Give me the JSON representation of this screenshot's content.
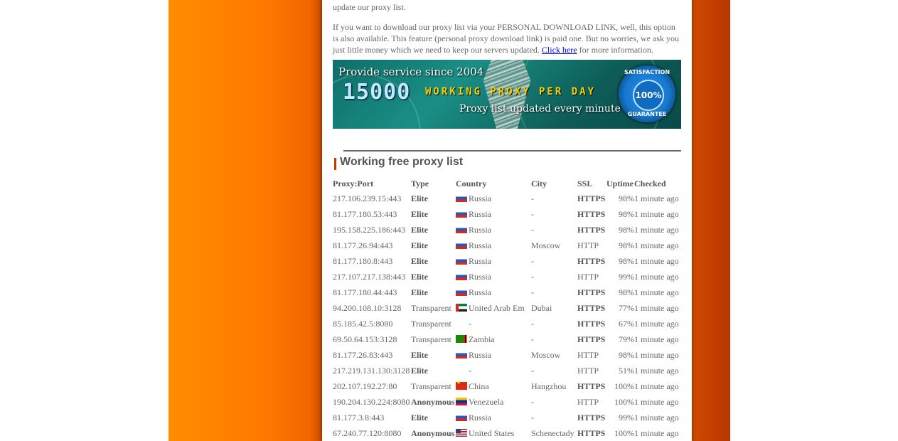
{
  "intro": {
    "para1_text": "update our proxy list.",
    "para2_text": "If you want to download our proxy list via your PERSONAL DOWNLOAD LINK, well, this option is also available. This feature (personal proxy download link) is paid one. But no worries, we ask you just little money which we need to keep our servers updated.",
    "link_label": "Click here",
    "para2_suffix": " for more information."
  },
  "banner": {
    "since": "Provide service since 2004",
    "count": "15000",
    "working": "WORKING PROXY PER DAY",
    "updated": "Proxy list updated every minute",
    "seal_top": "SATISFACTION",
    "seal_center": "100%",
    "seal_bottom": "GUARANTEE"
  },
  "section": {
    "title": "Working free proxy list"
  },
  "table": {
    "headers": [
      "Proxy:Port",
      "Type",
      "Country",
      "City",
      "SSL",
      "Uptime",
      "Checked"
    ],
    "rows": [
      {
        "proxy": "217.106.239.15:443",
        "type": "Elite",
        "flag": "ru",
        "country": "Russia",
        "city": "-",
        "ssl": "HTTPS",
        "uptime": "98%",
        "checked": "1 minute ago"
      },
      {
        "proxy": "81.177.180.53:443",
        "type": "Elite",
        "flag": "ru",
        "country": "Russia",
        "city": "-",
        "ssl": "HTTPS",
        "uptime": "98%",
        "checked": "1 minute ago"
      },
      {
        "proxy": "195.158.225.186:443",
        "type": "Elite",
        "flag": "ru",
        "country": "Russia",
        "city": "-",
        "ssl": "HTTPS",
        "uptime": "98%",
        "checked": "1 minute ago"
      },
      {
        "proxy": "81.177.26.94:443",
        "type": "Elite",
        "flag": "ru",
        "country": "Russia",
        "city": "Moscow",
        "ssl": "HTTP",
        "uptime": "98%",
        "checked": "1 minute ago"
      },
      {
        "proxy": "81.177.180.8:443",
        "type": "Elite",
        "flag": "ru",
        "country": "Russia",
        "city": "-",
        "ssl": "HTTPS",
        "uptime": "98%",
        "checked": "1 minute ago"
      },
      {
        "proxy": "217.107.217.138:443",
        "type": "Elite",
        "flag": "ru",
        "country": "Russia",
        "city": "-",
        "ssl": "HTTP",
        "uptime": "99%",
        "checked": "1 minute ago"
      },
      {
        "proxy": "81.177.180.44:443",
        "type": "Elite",
        "flag": "ru",
        "country": "Russia",
        "city": "-",
        "ssl": "HTTPS",
        "uptime": "98%",
        "checked": "1 minute ago"
      },
      {
        "proxy": "94.200.108.10:3128",
        "type": "Transparent",
        "flag": "ae",
        "country": "United Arab Em",
        "city": "Dubai",
        "ssl": "HTTPS",
        "uptime": "77%",
        "checked": "1 minute ago"
      },
      {
        "proxy": "85.185.42.5:8080",
        "type": "Transparent",
        "flag": "",
        "country": "-",
        "city": "-",
        "ssl": "HTTPS",
        "uptime": "67%",
        "checked": "1 minute ago"
      },
      {
        "proxy": "69.50.64.153:3128",
        "type": "Transparent",
        "flag": "zm",
        "country": "Zambia",
        "city": "-",
        "ssl": "HTTPS",
        "uptime": "79%",
        "checked": "1 minute ago"
      },
      {
        "proxy": "81.177.26.83:443",
        "type": "Elite",
        "flag": "ru",
        "country": "Russia",
        "city": "Moscow",
        "ssl": "HTTP",
        "uptime": "98%",
        "checked": "1 minute ago"
      },
      {
        "proxy": "217.219.131.130:3128",
        "type": "Elite",
        "flag": "",
        "country": "-",
        "city": "-",
        "ssl": "HTTP",
        "uptime": "51%",
        "checked": "1 minute ago"
      },
      {
        "proxy": "202.107.192.27:80",
        "type": "Transparent",
        "flag": "cn",
        "country": "China",
        "city": "Hangzhou",
        "ssl": "HTTPS",
        "uptime": "100%",
        "checked": "1 minute ago"
      },
      {
        "proxy": "190.204.130.224:8080",
        "type": "Anonymous",
        "flag": "ve",
        "country": "Venezuela",
        "city": "-",
        "ssl": "HTTP",
        "uptime": "100%",
        "checked": "1 minute ago"
      },
      {
        "proxy": "81.177.3.8:443",
        "type": "Elite",
        "flag": "ru",
        "country": "Russia",
        "city": "-",
        "ssl": "HTTPS",
        "uptime": "99%",
        "checked": "1 minute ago"
      },
      {
        "proxy": "67.240.77.120:8080",
        "type": "Anonymous",
        "flag": "us",
        "country": "United States",
        "city": "Schenectady",
        "ssl": "HTTPS",
        "uptime": "100%",
        "checked": "1 minute ago"
      }
    ]
  },
  "colors": {
    "left_gradient": "#ff8c00",
    "right_band": "#c44000",
    "accent_bar": "#c43b00",
    "body_text": "#666666",
    "link": "#0000ee"
  }
}
